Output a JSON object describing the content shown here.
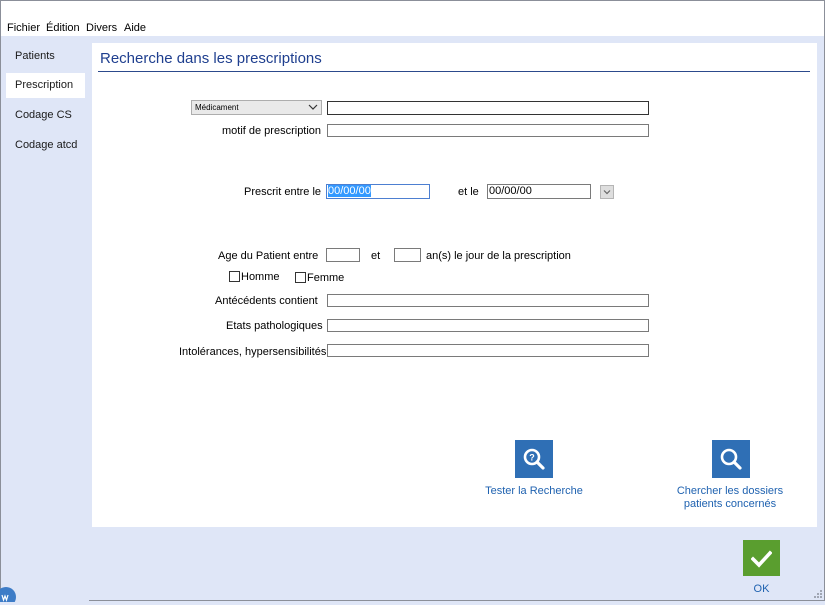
{
  "menu": {
    "items": [
      "Fichier",
      "Édition",
      "Divers",
      "Aide"
    ]
  },
  "sidebar": {
    "items": [
      {
        "label": "Patients"
      },
      {
        "label": "Prescription"
      },
      {
        "label": "Codage CS"
      },
      {
        "label": "Codage atcd"
      }
    ],
    "active_index": 1
  },
  "panel": {
    "title": "Recherche dans les prescriptions"
  },
  "form": {
    "type_select": {
      "value": "Médicament"
    },
    "type_value": "",
    "motif_label": "motif de prescription",
    "motif_value": "",
    "prescrit_label": "Prescrit entre le",
    "date_from": "00/00/00",
    "et_le_label": "et le",
    "date_to": "00/00/00",
    "age_label": "Age du Patient entre",
    "age_from": "",
    "et_label": "et",
    "age_to": "",
    "age_suffix": "an(s) le jour de la prescription",
    "homme_label": "Homme",
    "femme_label": "Femme",
    "antecedents_label": "Antécédents contient",
    "antecedents_value": "",
    "etats_label": "Etats pathologiques",
    "etats_value": "",
    "intolerances_label": "Intolérances, hypersensibilités",
    "intolerances_value": ""
  },
  "actions": {
    "test_label": "Tester la Recherche",
    "search_label_line1": "Chercher les dossiers",
    "search_label_line2": "patients concernés",
    "ok_label": "OK"
  },
  "colors": {
    "accent": "#2f6fb5",
    "ok_green": "#5a9e2f",
    "title_blue": "#1f3f8f",
    "background": "#dfe6f7"
  }
}
